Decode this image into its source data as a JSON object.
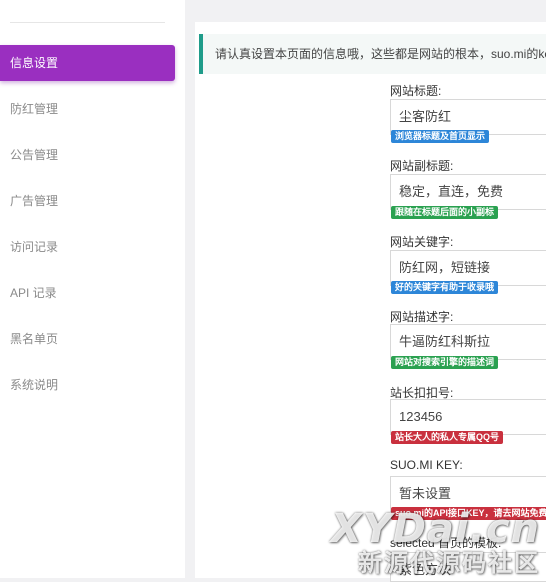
{
  "sidebar": {
    "items": [
      {
        "label": "信息设置",
        "active": true
      },
      {
        "label": "防红管理"
      },
      {
        "label": "公告管理"
      },
      {
        "label": "广告管理"
      },
      {
        "label": "访问记录"
      },
      {
        "label": "API 记录"
      },
      {
        "label": "黑名单页"
      },
      {
        "label": "系统说明"
      }
    ]
  },
  "notice": {
    "text": "请认真设置本页面的信息哦，这些都是网站的根本，suo.mi的key直接去"
  },
  "form": {
    "fields": [
      {
        "label": "网站标题:",
        "value": "尘客防红",
        "hint": "浏览器标题及首页显示",
        "hint_color": "#2d86d8"
      },
      {
        "label": "网站副标题:",
        "value": "稳定，直连，免费",
        "hint": "跟随在标题后面的小副标",
        "hint_color": "#2aa150"
      },
      {
        "label": "网站关键字:",
        "value": "防红网，短链接",
        "hint": "好的关键字有助于收录哦",
        "hint_color": "#2d86d8"
      },
      {
        "label": "网站描述字:",
        "value": "牛逼防红科斯拉",
        "hint": "网站对搜索引擎的描述词",
        "hint_color": "#2aa150"
      },
      {
        "label": "站长扣扣号:",
        "value": "123456",
        "hint": "站长大人的私人专属QQ号",
        "hint_color": "#c9303e"
      },
      {
        "label": "SUO.MI KEY:",
        "value": "暂未设置",
        "hint": "suo.mi的API接口KEY，请去网站免费",
        "hint_color": "#c9303e"
      }
    ],
    "template_label": "selected 首页的模板:",
    "template_value": "紫色方块"
  },
  "watermark": {
    "line1": "XYDai.cn",
    "line2": "新源代源码社区"
  }
}
